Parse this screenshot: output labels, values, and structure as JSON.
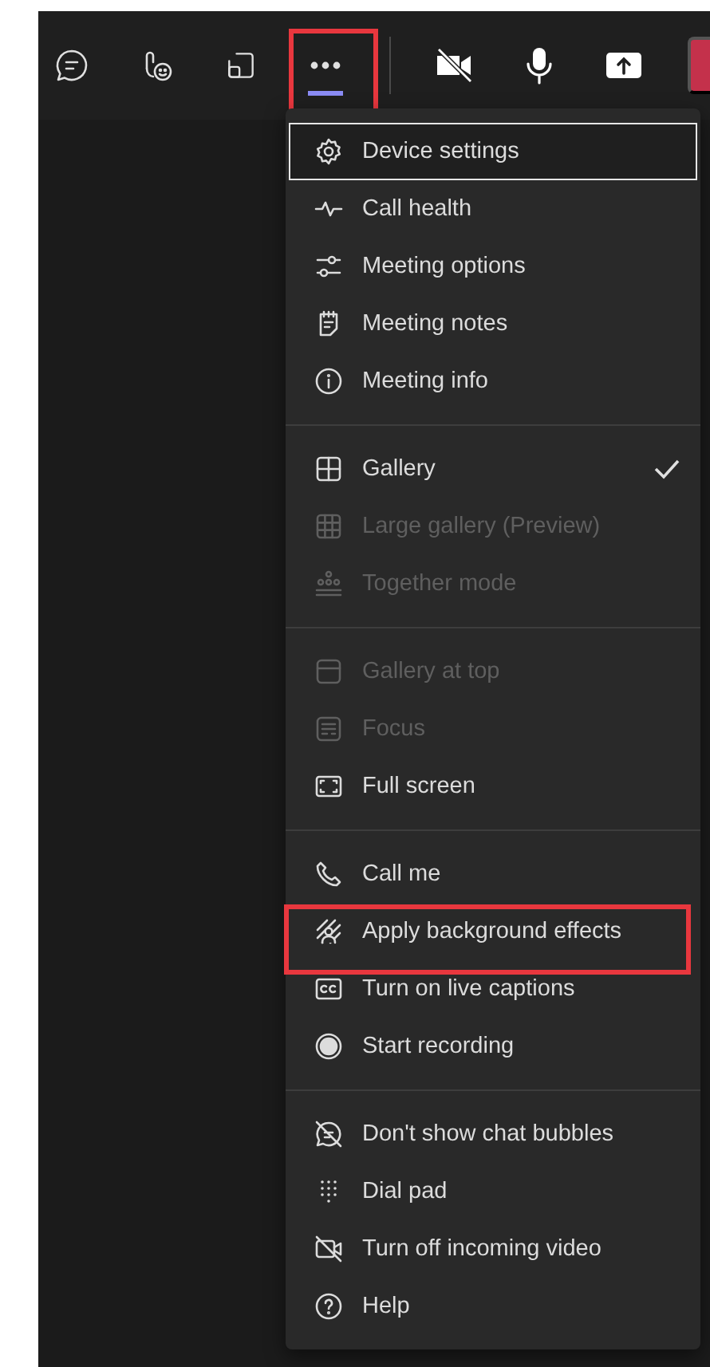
{
  "toolbar": {
    "buttons": [
      {
        "kind": "chat",
        "selected": false,
        "highlighted": false
      },
      {
        "kind": "react",
        "selected": false,
        "highlighted": false
      },
      {
        "kind": "tray",
        "selected": false,
        "highlighted": false
      },
      {
        "kind": "more",
        "selected": true,
        "highlighted": true
      },
      {
        "kind": "divider"
      },
      {
        "kind": "camera",
        "selected": false,
        "highlighted": false
      },
      {
        "kind": "mic",
        "selected": false,
        "highlighted": false
      },
      {
        "kind": "share",
        "selected": false,
        "highlighted": false
      },
      {
        "kind": "leave",
        "selected": false,
        "highlighted": false
      }
    ]
  },
  "menu": {
    "sections": [
      {
        "items": [
          {
            "label": "Device settings",
            "focused": true,
            "disabled": false,
            "checked": false,
            "highlighted": false
          },
          {
            "label": "Call health",
            "focused": false,
            "disabled": false,
            "checked": false,
            "highlighted": false
          },
          {
            "label": "Meeting options",
            "focused": false,
            "disabled": false,
            "checked": false,
            "highlighted": false
          },
          {
            "label": "Meeting notes",
            "focused": false,
            "disabled": false,
            "checked": false,
            "highlighted": false
          },
          {
            "label": "Meeting info",
            "focused": false,
            "disabled": false,
            "checked": false,
            "highlighted": false
          }
        ]
      },
      {
        "items": [
          {
            "label": "Gallery",
            "focused": false,
            "disabled": false,
            "checked": true,
            "highlighted": false
          },
          {
            "label": "Large gallery (Preview)",
            "focused": false,
            "disabled": true,
            "checked": false,
            "highlighted": false
          },
          {
            "label": "Together mode",
            "focused": false,
            "disabled": true,
            "checked": false,
            "highlighted": false
          }
        ]
      },
      {
        "items": [
          {
            "label": "Gallery at top",
            "focused": false,
            "disabled": true,
            "checked": false,
            "highlighted": false
          },
          {
            "label": "Focus",
            "focused": false,
            "disabled": true,
            "checked": false,
            "highlighted": false
          },
          {
            "label": "Full screen",
            "focused": false,
            "disabled": false,
            "checked": false,
            "highlighted": false
          }
        ]
      },
      {
        "items": [
          {
            "label": "Call me",
            "focused": false,
            "disabled": false,
            "checked": false,
            "highlighted": false
          },
          {
            "label": "Apply background effects",
            "focused": false,
            "disabled": false,
            "checked": false,
            "highlighted": true
          },
          {
            "label": "Turn on live captions",
            "focused": false,
            "disabled": false,
            "checked": false,
            "highlighted": false
          },
          {
            "label": "Start recording",
            "focused": false,
            "disabled": false,
            "checked": false,
            "highlighted": false
          }
        ]
      },
      {
        "items": [
          {
            "label": "Don't show chat bubbles",
            "focused": false,
            "disabled": false,
            "checked": false,
            "highlighted": false
          },
          {
            "label": "Dial pad",
            "focused": false,
            "disabled": false,
            "checked": false,
            "highlighted": false
          },
          {
            "label": "Turn off incoming video",
            "focused": false,
            "disabled": false,
            "checked": false,
            "highlighted": false
          },
          {
            "label": "Help",
            "focused": false,
            "disabled": false,
            "checked": false,
            "highlighted": false
          }
        ]
      }
    ]
  }
}
